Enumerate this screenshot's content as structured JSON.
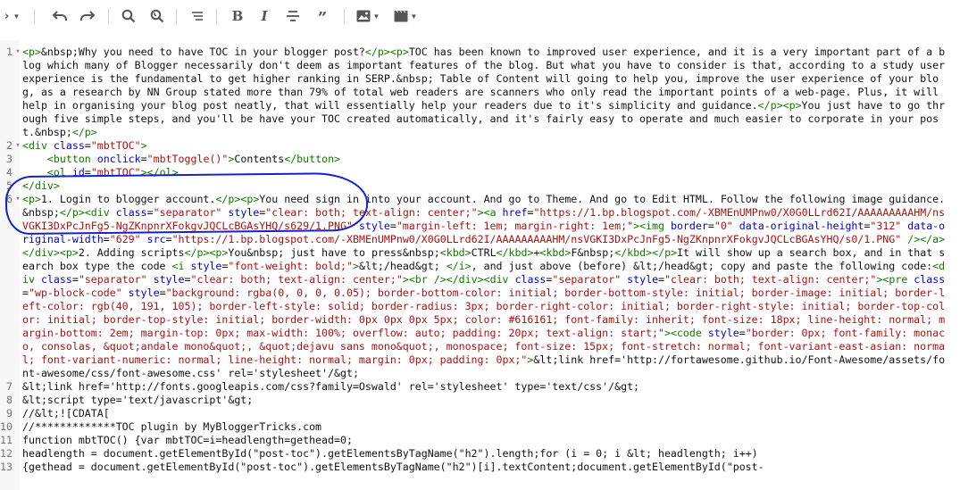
{
  "toolbar": {
    "items": [
      {
        "name": "view-mode",
        "icon": "code-brackets-icon",
        "label": "‹›"
      },
      {
        "name": "undo",
        "icon": "undo-icon"
      },
      {
        "name": "redo",
        "icon": "redo-icon"
      },
      {
        "name": "search",
        "icon": "search-icon"
      },
      {
        "name": "replace",
        "icon": "search-replace-icon"
      },
      {
        "name": "align",
        "icon": "align-icon"
      },
      {
        "name": "bold",
        "icon": "bold-icon",
        "label": "B"
      },
      {
        "name": "italic",
        "icon": "italic-icon",
        "label": "I"
      },
      {
        "name": "strikethrough",
        "icon": "strikethrough-icon"
      },
      {
        "name": "quote",
        "icon": "quote-icon",
        "label": "”"
      },
      {
        "name": "image",
        "icon": "image-icon"
      },
      {
        "name": "video",
        "icon": "video-icon"
      }
    ]
  },
  "annotation_color": "#1422c8",
  "colors": {
    "tag": "#117700",
    "attr_name": "#0000cc",
    "attr_value": "#aa1111",
    "text": "#111111"
  },
  "lines": [
    {
      "num": "1",
      "fold": "▾",
      "text": "<p>&nbsp;Why you need to have TOC in your blogger post?</p><p>TOC has been known to improved user experience, and it is a very important part of a blog which many of Blogger necessarily don't deem as important features of the blog. But what you have to consider is that, according to a study user experience is the fundamental to get higher ranking in SERP.&nbsp; Table of Content will going to help you, improve the user experience of your blog, as a research by NN Group stated more than 79% of total web readers are scanners who only read the important points of a web-page. Plus, it will help in organising your blog post neatly, that will essentially help your readers due to it's simplicity and guidance.</p><p>You just have to go through five simple steps, and you'll be have your TOC created automatically, and it's fairly easy to operate and much easier to corporate in your post.&nbsp;</p>"
    },
    {
      "num": "2",
      "fold": "▾",
      "text": "<div class=\"mbtTOC\">"
    },
    {
      "num": "3",
      "fold": "",
      "text": "    <button onclick=\"mbtToggle()\">Contents</button>"
    },
    {
      "num": "4",
      "fold": "",
      "text": "    <ol id=\"mbtTOC\"></ol>"
    },
    {
      "num": "5",
      "fold": "",
      "text": "</div>"
    },
    {
      "num": "6",
      "fold": "▾",
      "text": "<p>1. Login to blogger account.</p><p>You need sign in into your account. And go to Theme. And go to Edit HTML. Follow the following image guidance.&nbsp;</p><div class=\"separator\" style=\"clear: both; text-align: center;\"><a href=\"https://1.bp.blogspot.com/-XBMEnUMPnw0/X0G0LLrd62I/AAAAAAAAAHM/nsVGKI3DxPcJnFg5-NgZKnpnrXFokgvJQCLcBGAsYHQ/s629/1.PNG\" style=\"margin-left: 1em; margin-right: 1em;\"><img border=\"0\" data-original-height=\"312\" data-original-width=\"629\" src=\"https://1.bp.blogspot.com/-XBMEnUMPnw0/X0G0LLrd62I/AAAAAAAAAHM/nsVGKI3DxPcJnFg5-NgZKnpnrXFokgvJQCLcBGAsYHQ/s0/1.PNG\" /></a></div><p>2. Adding scripts</p><p>You&nbsp; just have to press&nbsp;<kbd>CTRL</kbd>+<kbd>F&nbsp;</kbd></p>It will show up a search box, and in that search box type the code <i style=\"font-weight: bold;\">&lt;/head&gt; </i>, and just above (before) &lt;/head&gt; copy and paste the following code:<div class=\"separator\" style=\"clear: both; text-align: center;\"><br /></div><div class=\"separator\" style=\"clear: both; text-align: center;\"><pre class=\"wp-block-code\" style=\"background: rgba(0, 0, 0, 0.05); border-bottom-color: initial; border-bottom-style: initial; border-image: initial; border-left-color: rgb(40, 191, 105); border-left-style: solid; border-radius: 3px; border-right-color: initial; border-right-style: initial; border-top-color: initial; border-top-style: initial; border-width: 0px 0px 0px 5px; color: #616161; font-family: inherit; font-size: 18px; line-height: normal; margin-bottom: 2em; margin-top: 0px; max-width: 100%; overflow: auto; padding: 20px; text-align: start;\"><code style=\"border: 0px; font-family: monaco, consolas, &quot;andale mono&quot;, &quot;dejavu sans mono&quot;, monospace; font-size: 15px; font-stretch: normal; font-variant-east-asian: normal; font-variant-numeric: normal; line-height: normal; margin: 0px; padding: 0px;\">&lt;link href='http://fortawesome.github.io/Font-Awesome/assets/font-awesome/css/font-awesome.css' rel='stylesheet'/&gt;"
    },
    {
      "num": "7",
      "fold": "",
      "text": "&lt;link href='http://fonts.googleapis.com/css?family=Oswald' rel='stylesheet' type='text/css'/&gt;"
    },
    {
      "num": "8",
      "fold": "",
      "text": "&lt;script type='text/javascript'&gt;"
    },
    {
      "num": "9",
      "fold": "",
      "text": "//&lt;![CDATA["
    },
    {
      "num": "10",
      "fold": "",
      "text": "//*************TOC plugin by MyBloggerTricks.com"
    },
    {
      "num": "11",
      "fold": "",
      "text": "function mbtTOC() {var mbtTOC=i=headlength=gethead=0;"
    },
    {
      "num": "12",
      "fold": "",
      "text": "headlength = document.getElementById(\"post-toc\").getElementsByTagName(\"h2\").length;for (i = 0; i &lt; headlength; i++)"
    },
    {
      "num": "13",
      "fold": "",
      "text": "{gethead = document.getElementById(\"post-toc\").getElementsByTagName(\"h2\")[i].textContent;document.getElementById(\"post-"
    }
  ]
}
